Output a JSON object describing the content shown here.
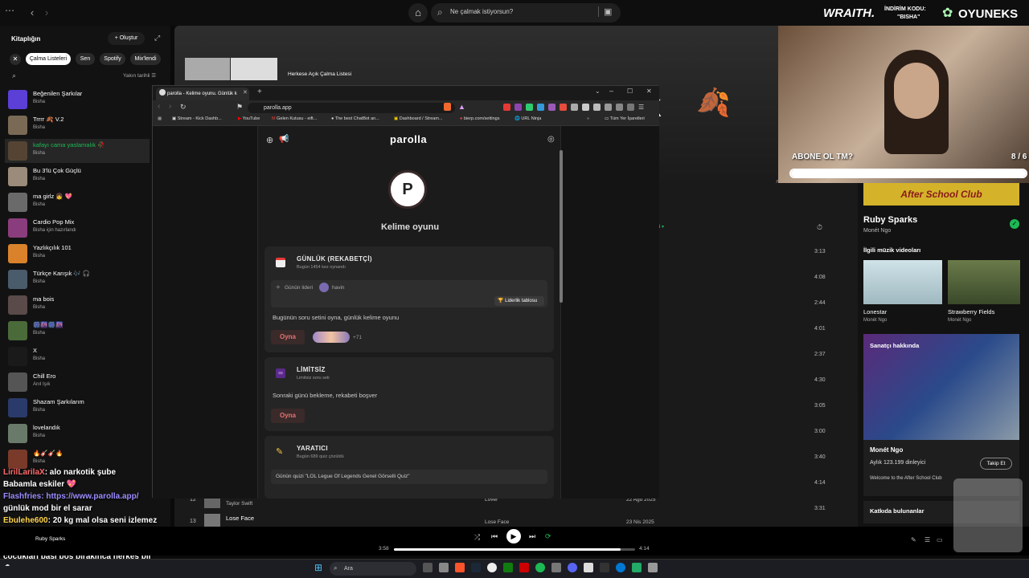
{
  "spotify": {
    "search_placeholder": "Ne çalmak istiyorsun?",
    "library": {
      "title": "Kitaplığın",
      "create": "Oluştur",
      "chips": [
        "Çalma Listeleri",
        "Sen",
        "Spotify",
        "Mix'lendi"
      ],
      "sort": "Yakın tarihli",
      "items": [
        {
          "name": "Beğenilen Şarkılar",
          "sub": "Bisha",
          "color": "#5b3fd6"
        },
        {
          "name": "Trrrr 🍂 V.2",
          "sub": "Bisha",
          "color": "#7a6a55"
        },
        {
          "name": "kafayı cama yaslamalık 🥀",
          "sub": "Bisha",
          "color": "#554433"
        },
        {
          "name": "Bu 3'lü Çok Güçlü",
          "sub": "Bisha",
          "color": "#9b8b7a"
        },
        {
          "name": "ma girlz 👧 💖",
          "sub": "Bisha",
          "color": "#6a6a6a"
        },
        {
          "name": "Cardio Pop Mix",
          "sub": "Bisha için hazırlandı",
          "color": "#8a3d7c"
        },
        {
          "name": "Yazlıkçılık 101",
          "sub": "Bisha",
          "color": "#d9822b"
        },
        {
          "name": "Türkçe Karışık 🎶 🎧",
          "sub": "Bisha",
          "color": "#4a5b6c"
        },
        {
          "name": "ma bois",
          "sub": "Bisha",
          "color": "#5a4a4a"
        },
        {
          "name": "🎆🌆🎆🌆",
          "sub": "Bisha",
          "color": "#4a6a3a"
        },
        {
          "name": "X",
          "sub": "Bisha",
          "color": "#1a1a1a"
        },
        {
          "name": "Chill Ero",
          "sub": "Anıl Işık",
          "color": "#555555"
        },
        {
          "name": "Shazam Şarkılarım",
          "sub": "Bisha",
          "color": "#2a3a6a"
        },
        {
          "name": "lovelandık",
          "sub": "Bisha",
          "color": "#6a7a6a"
        },
        {
          "name": "🔥🎸🎸🔥",
          "sub": "Bisha",
          "color": "#7a3a2a"
        }
      ]
    },
    "main": {
      "playlist_label": "Herkese Açık Çalma Listesi",
      "hero_text": "k",
      "sort_label": "Yeni eklenenler",
      "durations": [
        "3:13",
        "4:08",
        "2:44",
        "4:01",
        "2:37",
        "4:30",
        "3:05",
        "3:00",
        "3:40",
        "4:14",
        "3:31",
        "3:20"
      ],
      "bottom_rows": [
        {
          "num": "12",
          "artist": "Taylor Swift",
          "album": "Lover",
          "date": "22 Ağu 2025",
          "dur": "3:20"
        },
        {
          "num": "13",
          "title": "Lose Face",
          "album": "Lose Face",
          "date": "23 Nis 2025",
          "dur": ""
        }
      ]
    },
    "right": {
      "artist": "Ruby Sparks",
      "artist_sub": "Monét Ngo",
      "videos_title": "İlgili müzik videoları",
      "videos": [
        {
          "title": "Lonestar",
          "sub": "Monét Ngo"
        },
        {
          "title": "Strawberry Fields",
          "sub": "Monét Ngo"
        }
      ],
      "about_title": "Sanatçı hakkında",
      "about_name": "Monét Ngo",
      "listeners": "Aylık 123.199 dinleyici",
      "follow": "Takip Et",
      "about_text": "Welcome to the After School Club",
      "contributors": "Katkıda bulunanlar",
      "banner": "After School Club"
    },
    "player": {
      "elapsed": "3:58",
      "total": "4:14",
      "progress": 0.94,
      "now_playing": "Ruby Sparks"
    }
  },
  "browser": {
    "tab_title": "parolla - Kelime oyunu. Günlük k",
    "url": "parolla.app",
    "bookmarks": [
      "Stream - Kick Dashb...",
      "YouTube",
      "Gelen Kutusu - eift...",
      "The best ChatBot an...",
      "Dashboard / Stream...",
      "bierp.com/settings",
      "URL Ninja",
      "Tüm Yer İşaretleri"
    ]
  },
  "parolla": {
    "logo": "parolla",
    "avatar_letter": "P",
    "game_title": "Kelime oyunu",
    "daily": {
      "title": "GÜNLÜK (REKABETÇİ)",
      "sub": "Bugün 1454 kez oynandı",
      "leader_label": "Günün lideri",
      "leader_name": "havin",
      "leaderboard": "Liderlik tablosu",
      "desc": "Bugünün soru setini oyna, günlük kelime oyunu",
      "play": "Oyna",
      "extra": "+71"
    },
    "unlimited": {
      "title": "LİMİTSİZ",
      "sub": "Limitsiz soru seti",
      "desc": "Sonraki günü bekleme, rekabeti boşver",
      "play": "Oyna"
    },
    "creator": {
      "title": "YARATICI",
      "sub": "Bugün 689 quiz çözüldü",
      "quiz": "Günün quizi \"LOL Legue Of Legends Genel Görselli Quiz\""
    }
  },
  "stream": {
    "sponsor": "WRAITH.",
    "discount_label": "İNDİRİM KODU:",
    "discount_code": "\"BISHA\"",
    "brand": "OYUNEKS",
    "sub_goal": "ABONE OL TM?",
    "sub_count": "8 / 6"
  },
  "chat": [
    {
      "user": "LirilLarilaX",
      "msg": ": alo narkotik şube",
      "color": "#ff6b6b"
    },
    {
      "user": "",
      "msg": "Babamla eskiler 💖",
      "color": "#ffffff"
    },
    {
      "user": "Flashfries",
      "msg": ": https://www.parolla.app/",
      "color": "#9b8cff"
    },
    {
      "user": "",
      "msg": "günlük mod bir el sarar",
      "color": "#ffffff"
    },
    {
      "user": "Ebulehe600",
      "msg": ": 20 kg mal olsa seni izlemez",
      "color": "#ffd54f"
    },
    {
      "user": "",
      "msg": "abla",
      "color": "#ffffff"
    },
    {
      "user": "Sultan_Burhi_Camisi",
      "msg": ": Sen bu",
      "color": "#66ff66"
    },
    {
      "user": "",
      "msg": "çocukları başı boş bırakınca herkes bir",
      "color": "#ffffff"
    },
    {
      "user": "",
      "msg": "şeylere düştü",
      "color": "#ffffff"
    }
  ],
  "taskbar": {
    "search": "Ara"
  }
}
